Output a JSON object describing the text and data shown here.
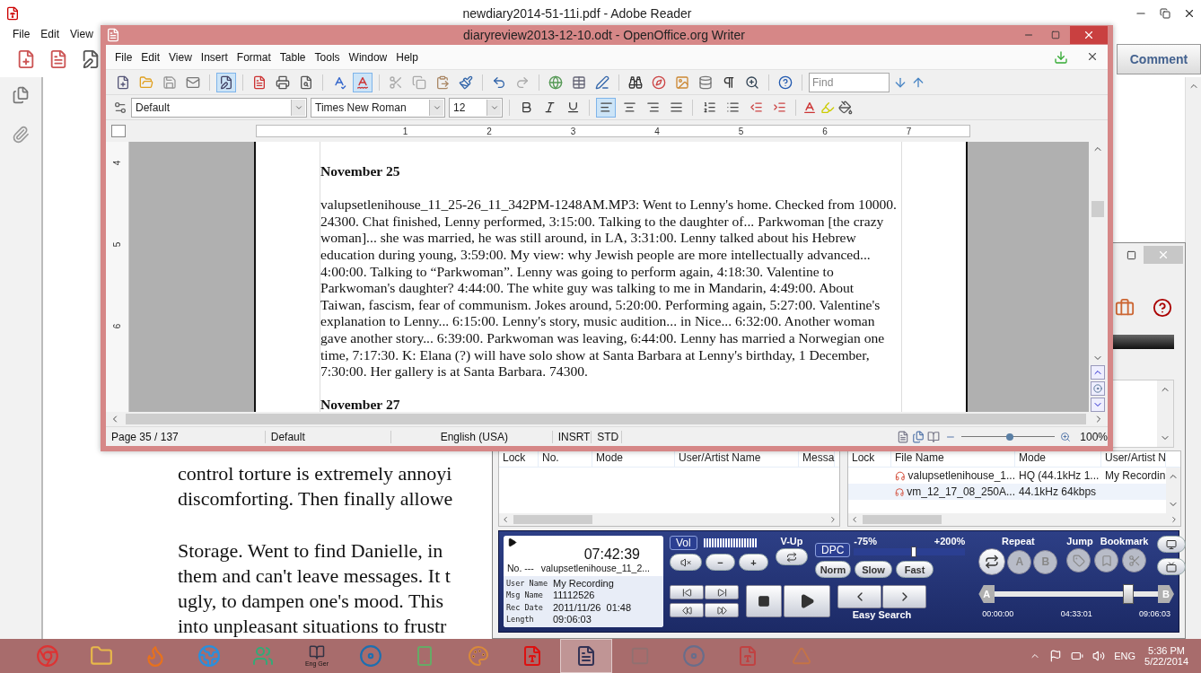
{
  "reader": {
    "title": "newdiary2014-51-11i.pdf - Adobe Reader",
    "menu": [
      "File",
      "Edit",
      "View"
    ],
    "comment_button": "Comment",
    "paragraphs": [
      [
        "control torture is extremely annoyi",
        "discomforting. Then finally allowe"
      ],
      [
        "Storage. Went to find Danielle, in",
        "them and can't leave messages. It t",
        "ugly, to dampen one's mood. This",
        "into unpleasant situations to frustr"
      ]
    ]
  },
  "writer": {
    "title": "diaryreview2013-12-10.odt - OpenOffice.org Writer",
    "menu": [
      "File",
      "Edit",
      "View",
      "Insert",
      "Format",
      "Table",
      "Tools",
      "Window",
      "Help"
    ],
    "edit_mode": {
      "on": true
    },
    "autospell": {
      "on": true
    },
    "find": {
      "placeholder": "Find"
    },
    "style": "Default",
    "font": "Times New Roman",
    "size": "12",
    "alignment": [
      {
        "selected": true
      },
      {
        "selected": false
      },
      {
        "selected": false
      },
      {
        "selected": false
      }
    ],
    "ruler_numbers": [
      "1",
      "2",
      "3",
      "4",
      "5",
      "6",
      "7"
    ],
    "vertical_ruler_numbers": [
      "4",
      "5",
      "6"
    ],
    "document": [
      {
        "kind": "heading",
        "text": "November 25"
      },
      {
        "kind": "paragraph",
        "text": "valupsetlenihouse_11_25-26_11_342PM-1248AM.MP3: Went to Lenny's home. Checked from 10000. 24300. Chat finished, Lenny performed, 3:15:00. Talking to the daughter of... Parkwoman [the crazy woman]... she was married, he was still around, in LA, 3:31:00. Lenny talked about his Hebrew education during young, 3:59:00. My view: why Jewish people are more intellectually advanced... 4:00:00. Talking to “Parkwoman”. Lenny was going to perform again, 4:18:30. Valentine to Parkwoman's daughter? 4:44:00. The white guy was talking to me in Mandarin, 4:49:00. About Taiwan, fascism, fear of communism. Jokes around, 5:20:00. Performing again, 5:27:00. Valentine's explanation to Lenny... 6:15:00. Lenny's story, music audition... in Nice... 6:32:00. Another woman gave another story... 6:39:00. Parkwoman was leaving, 6:44:00. Lenny has married a Norwegian one time, 7:17:30. K: Elana (?) will have solo show at Santa Barbara at Lenny's birthday, 1 December, 7:30:00. Her gallery is at Santa Barbara. 74300."
      },
      {
        "kind": "heading",
        "text": "November 27"
      }
    ],
    "status": {
      "page": "Page 35 / 137",
      "style": "Default",
      "language": "English (USA)",
      "insert_mode": "INSRT",
      "selection_mode": "STD",
      "zoom": "100%"
    },
    "zoom_slider": {
      "level": 0.52
    }
  },
  "recorder": {
    "folder_list": {
      "columns": [
        "Lock",
        "No.",
        "Mode",
        "User/Artist Name",
        "Messa"
      ]
    },
    "file_list": {
      "columns": [
        "Lock",
        "File Name",
        "Mode",
        "User/Artist N"
      ],
      "rows": [
        {
          "file_name": "valupsetlenihouse_1...",
          "mode": "HQ (44.1kHz 1...",
          "user": "My Recordin"
        },
        {
          "file_name": "vm_12_17_08_250A...",
          "mode": "44.1kHz 64kbps"
        }
      ]
    },
    "player": {
      "time": "07:42:39",
      "number": "No. ---",
      "file": "valupsetlenihouse_11_2...",
      "info": [
        {
          "label": "User Name",
          "value": "My Recording"
        },
        {
          "label": "Msg Name",
          "value": "11112526"
        },
        {
          "label": "Rec Date",
          "value": "2011/11/26  01:48"
        },
        {
          "label": "Length",
          "value": "09:06:03"
        }
      ],
      "vol_label": "Vol",
      "volume": {
        "level": 1
      },
      "minus": "−",
      "plus": "+",
      "vup_label": "V-Up",
      "dpc_label": "DPC",
      "speed_min": "-75%",
      "speed_max": "+200%",
      "speed": {
        "level": 0.54
      },
      "norm": "Norm",
      "slow": "Slow",
      "fast": "Fast",
      "easy_search": "Easy Search",
      "repeat_label": "Repeat",
      "repeat_a": "A",
      "repeat_b": "B",
      "jump_label": "Jump",
      "bookmark_label": "Bookmark",
      "position": {
        "level": 0.82
      },
      "position_start": "A",
      "position_end": "B",
      "times": [
        "00:00:00",
        "04:33:01",
        "09:06:03"
      ]
    }
  },
  "taskbar": {
    "apps": [
      {
        "kind": "chrome",
        "active": false,
        "dimmed": false
      },
      {
        "kind": "folder",
        "active": false,
        "dimmed": false
      },
      {
        "kind": "firefox",
        "active": false,
        "dimmed": false
      },
      {
        "kind": "ie",
        "active": false,
        "dimmed": false
      },
      {
        "kind": "people",
        "active": false,
        "dimmed": false
      },
      {
        "kind": "book",
        "active": false,
        "dimmed": false,
        "label": "Eng Ger"
      },
      {
        "kind": "disc",
        "active": false,
        "dimmed": false
      },
      {
        "kind": "device",
        "active": false,
        "dimmed": false
      },
      {
        "kind": "paint",
        "active": false,
        "dimmed": false
      },
      {
        "kind": "pdf",
        "active": false,
        "dimmed": false
      },
      {
        "kind": "writer",
        "active": true,
        "dimmed": false
      },
      {
        "kind": "blank",
        "active": false,
        "dimmed": true
      },
      {
        "kind": "disc",
        "active": false,
        "dimmed": true
      },
      {
        "kind": "pdf",
        "active": false,
        "dimmed": true
      },
      {
        "kind": "cone",
        "active": false,
        "dimmed": true
      }
    ],
    "language": "ENG",
    "time": "5:36 PM",
    "date": "5/22/2014"
  }
}
